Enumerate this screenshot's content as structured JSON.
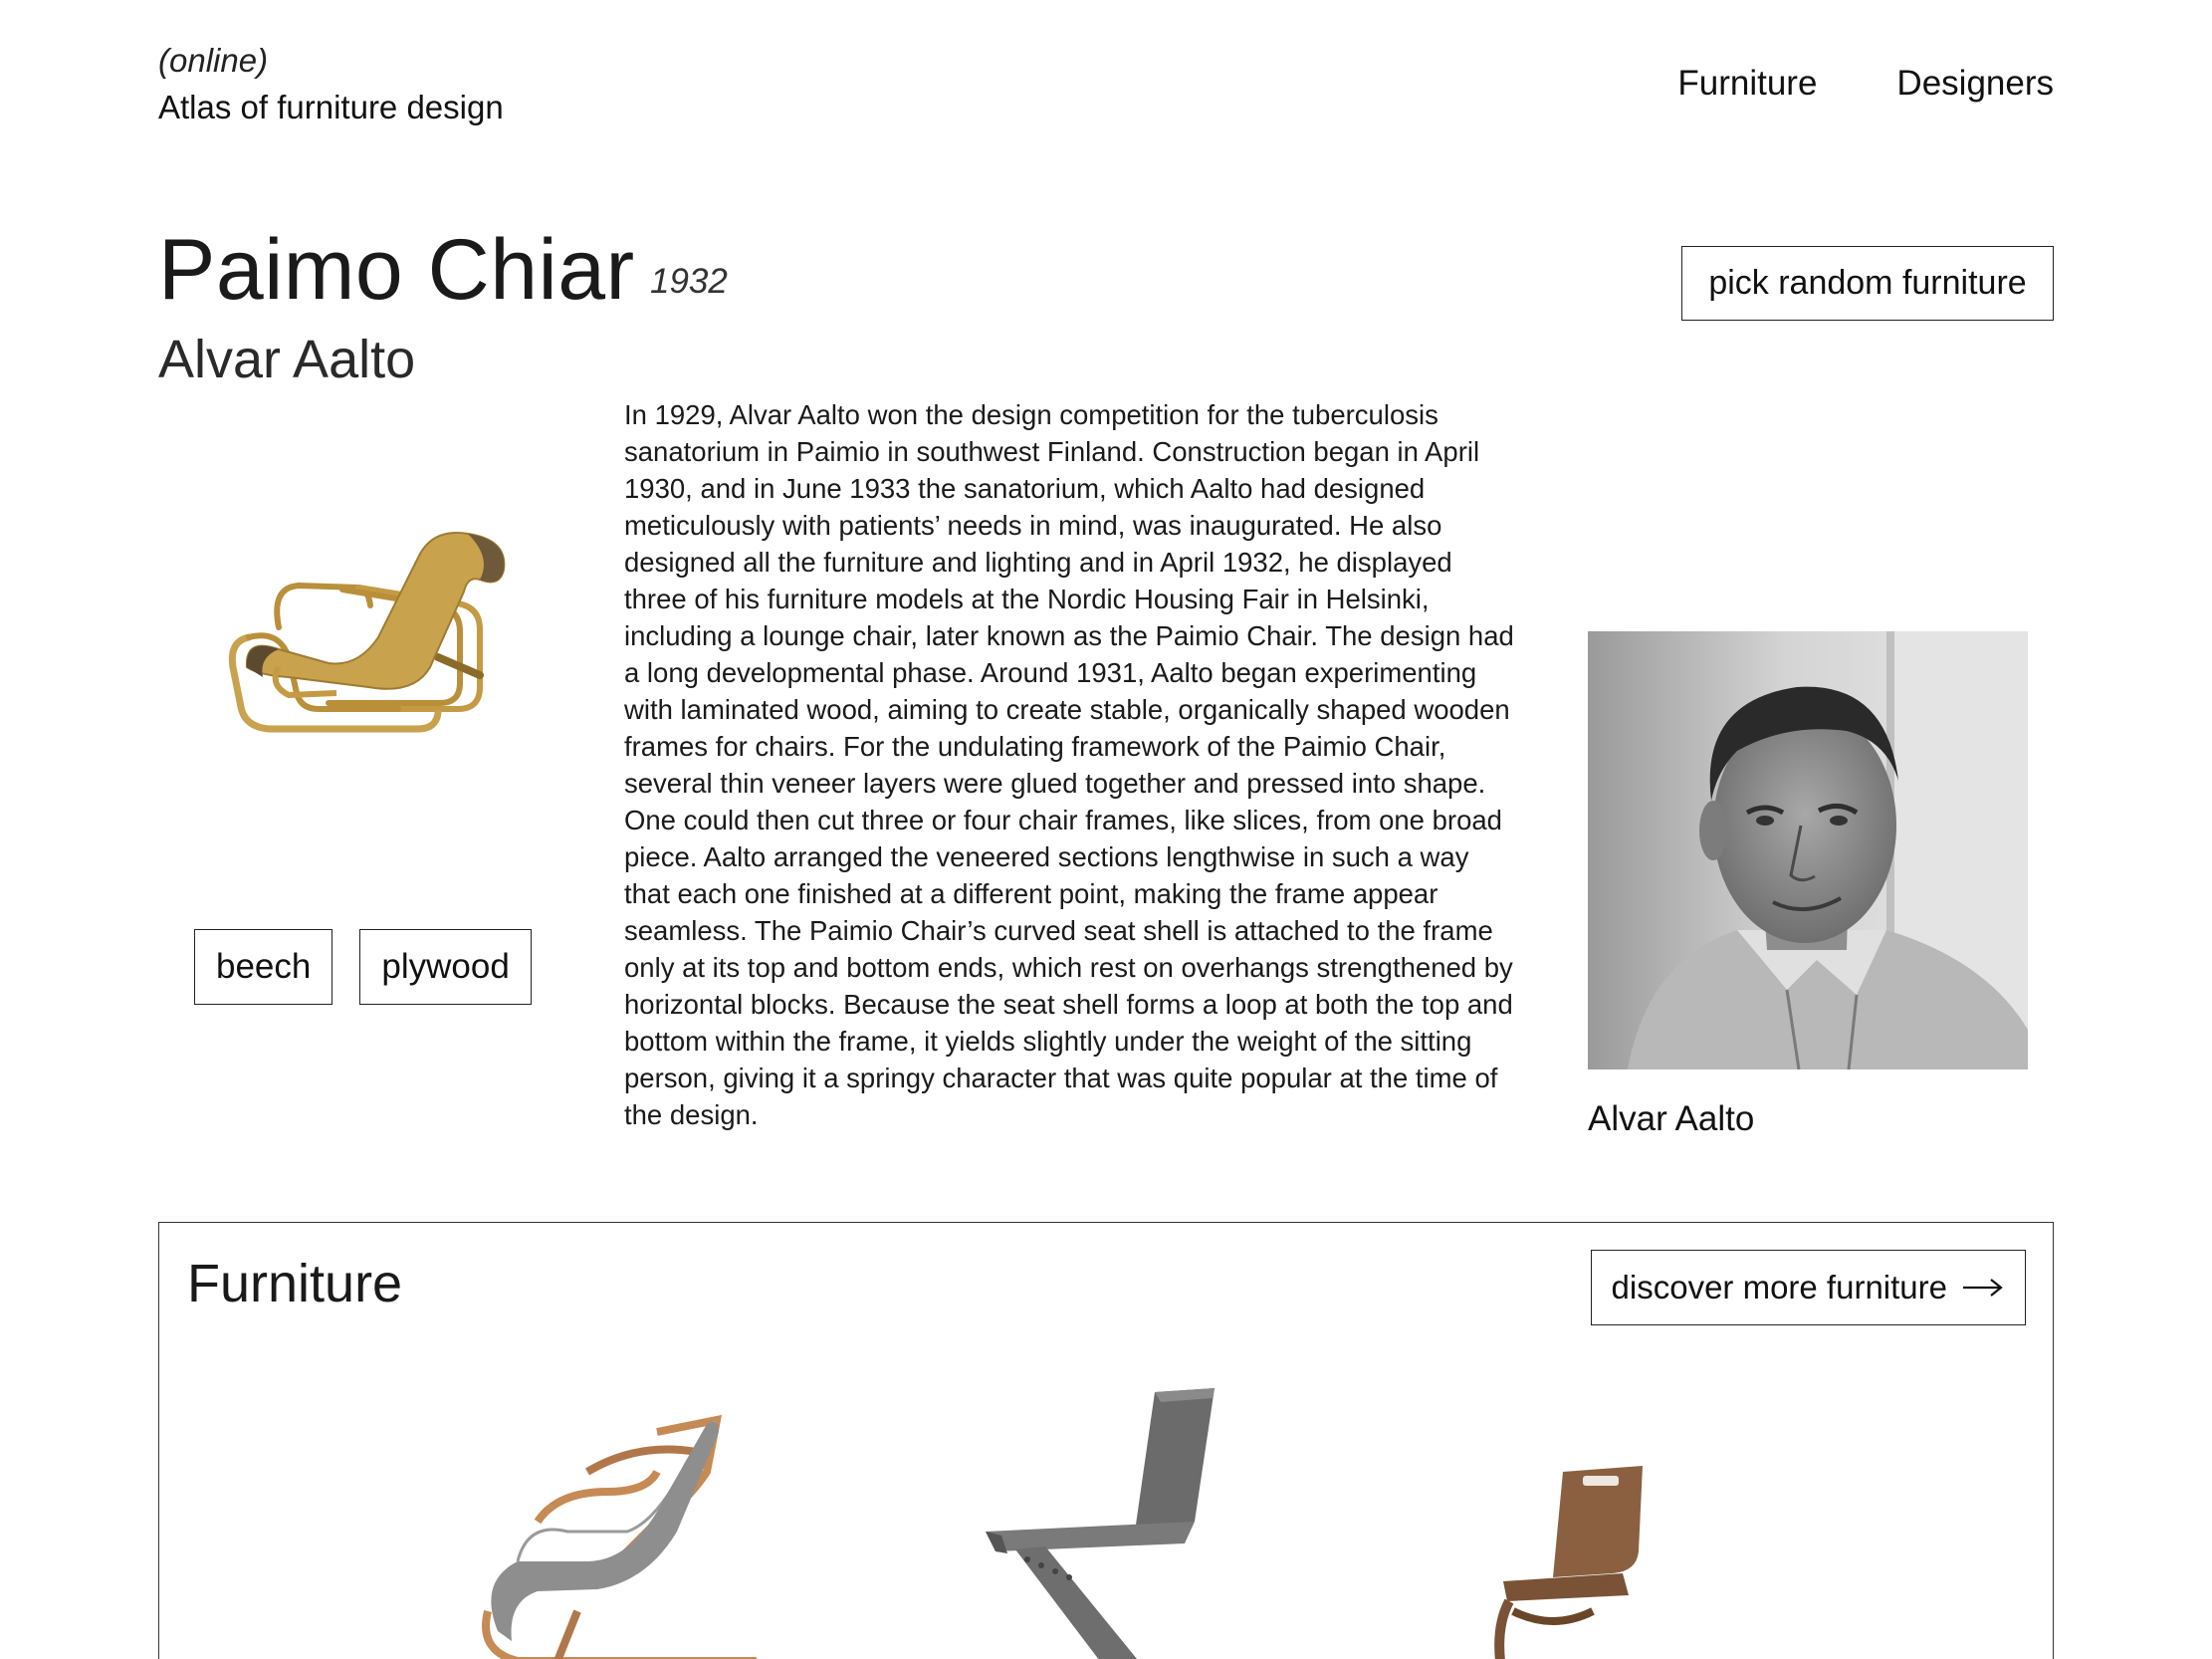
{
  "header": {
    "tagline": "(online)",
    "title": "Atlas of furniture design",
    "nav": [
      {
        "label": "Furniture"
      },
      {
        "label": "Designers"
      }
    ]
  },
  "product": {
    "name": "Paimo Chiar",
    "year": "1932",
    "designer": "Alvar Aalto",
    "materials": [
      "beech",
      "plywood"
    ],
    "description": "In 1929, Alvar Aalto won the design competition for the tuberculosis sanatorium in Paimio in southwest Finland. Construction began in April 1930, and in June 1933 the sanatorium, which Aalto had designed meticulously with patients’ needs in mind, was inaugurated. He also designed all the furniture and lighting and in April 1932, he displayed three of his furniture models at the Nordic Housing Fair in Helsinki, including a lounge chair, later known as the Paimio Chair. The design had a long developmental phase. Around 1931, Aalto began experimenting with laminated wood, aiming to create stable, organically shaped wooden frames for chairs. For the undulating framework of the Paimio Chair, several thin veneer layers were glued together and pressed into shape. One could then cut three or four chair frames, like slices, from one broad piece. Aalto arranged the veneered sections lengthwise in such a way that each one finished at a different point, making the frame appear seamless. The Paimio Chair’s curved seat shell is attached to the frame only at its top and bottom ends, which rest on overhangs strengthened by horizontal blocks. Because the seat shell forms a loop at both the top and bottom within the frame, it yields slightly under the weight of the sitting person, giving it a springy character that was quite popular at the time of the design."
  },
  "actions": {
    "random_label": "pick random furniture"
  },
  "designer_card": {
    "name": "Alvar Aalto"
  },
  "furniture_section": {
    "title": "Furniture",
    "discover_label": "discover more furniture"
  },
  "colors": {
    "text": "#1a1a1a",
    "border": "#222222",
    "background": "#ffffff",
    "wood": "#c9a24e"
  }
}
